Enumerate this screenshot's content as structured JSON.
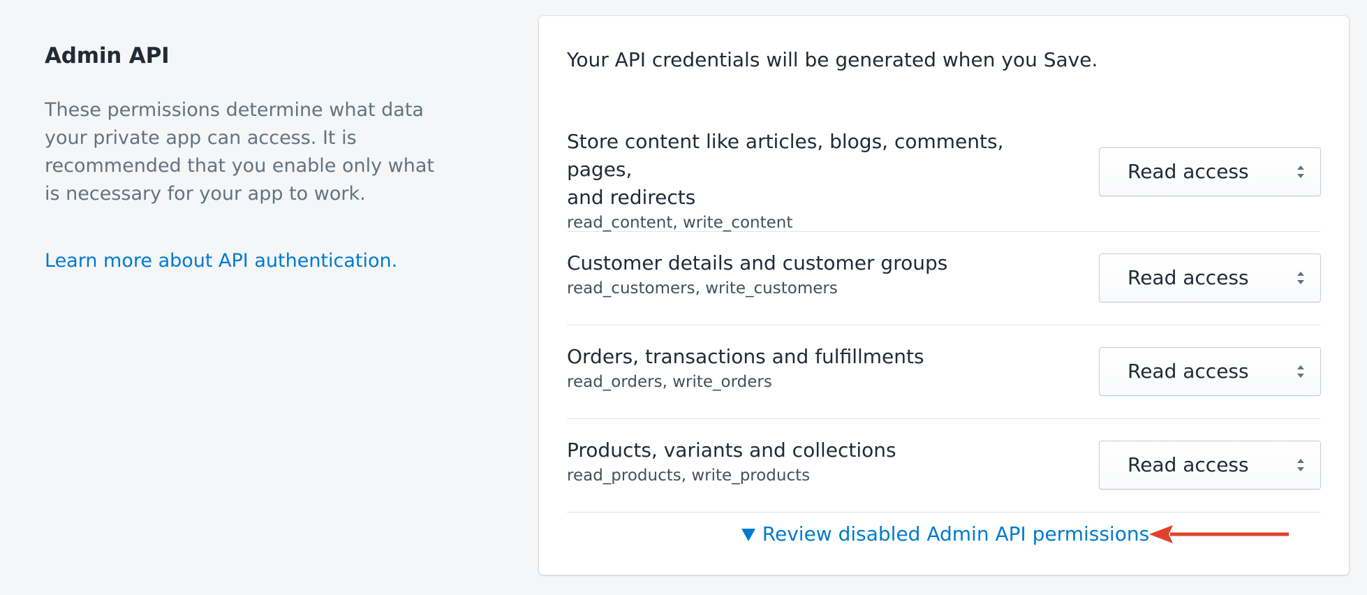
{
  "left": {
    "title": "Admin API",
    "description": "These permissions determine what data your private app can access. It is recommended that you enable only what is necessary for your app to work.",
    "learn_more_link": "Learn more about API authentication."
  },
  "card": {
    "intro": "Your API credentials will be generated when you Save.",
    "permissions": [
      {
        "title_line1": "Store content like articles, blogs, comments, pages,",
        "title_line2": "and redirects",
        "scopes": "read_content, write_content",
        "access": "Read access"
      },
      {
        "title": "Customer details and customer groups",
        "scopes": "read_customers, write_customers",
        "access": "Read access"
      },
      {
        "title": "Orders, transactions and fulfillments",
        "scopes": "read_orders, write_orders",
        "access": "Read access"
      },
      {
        "title": "Products, variants and collections",
        "scopes": "read_products, write_products",
        "access": "Read access"
      }
    ],
    "review_link": "Review disabled Admin API permissions"
  },
  "icons": {
    "select_arrows": "select-arrows-icon",
    "disclosure_triangle": "triangle-down-icon",
    "annotation_arrow": "arrow-left-icon"
  },
  "colors": {
    "link": "#007ace",
    "annotation_arrow": "#e0412c",
    "background": "#f4f6f8"
  }
}
